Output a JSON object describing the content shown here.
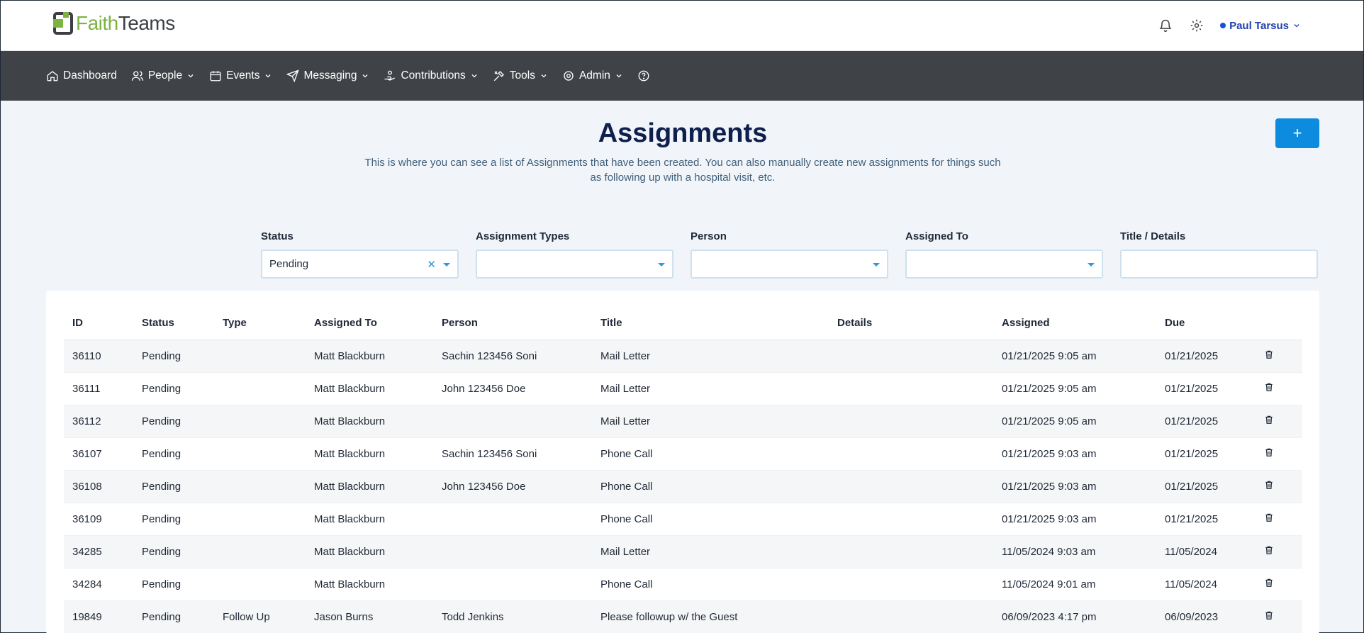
{
  "app": {
    "logo_part1": "Faith",
    "logo_part2": "Teams"
  },
  "header": {
    "user_name": "Paul Tarsus"
  },
  "nav": [
    {
      "label": "Dashboard",
      "icon": "home-icon",
      "dropdown": false
    },
    {
      "label": "People",
      "icon": "people-icon",
      "dropdown": true
    },
    {
      "label": "Events",
      "icon": "calendar-icon",
      "dropdown": true
    },
    {
      "label": "Messaging",
      "icon": "send-icon",
      "dropdown": true
    },
    {
      "label": "Contributions",
      "icon": "hand-coin-icon",
      "dropdown": true
    },
    {
      "label": "Tools",
      "icon": "tools-icon",
      "dropdown": true
    },
    {
      "label": "Admin",
      "icon": "gear-icon",
      "dropdown": true
    }
  ],
  "page": {
    "title": "Assignments",
    "description": "This is where you can see a list of Assignments that have been created. You can also manually create new assignments for things such as following up with a hospital visit, etc.",
    "add_label": "+"
  },
  "filters": {
    "status_label": "Status",
    "status_value": "Pending",
    "types_label": "Assignment Types",
    "types_value": "",
    "person_label": "Person",
    "person_value": "",
    "assigned_to_label": "Assigned To",
    "assigned_to_value": "",
    "title_label": "Title / Details",
    "title_value": ""
  },
  "table": {
    "headers": [
      "ID",
      "Status",
      "Type",
      "Assigned To",
      "Person",
      "Title",
      "Details",
      "Assigned",
      "Due",
      ""
    ],
    "rows": [
      [
        "36110",
        "Pending",
        "",
        "Matt Blackburn",
        "Sachin 123456 Soni",
        "Mail Letter",
        "",
        "01/21/2025 9:05 am",
        "01/21/2025"
      ],
      [
        "36111",
        "Pending",
        "",
        "Matt Blackburn",
        "John 123456 Doe",
        "Mail Letter",
        "",
        "01/21/2025 9:05 am",
        "01/21/2025"
      ],
      [
        "36112",
        "Pending",
        "",
        "Matt Blackburn",
        "",
        "Mail Letter",
        "",
        "01/21/2025 9:05 am",
        "01/21/2025"
      ],
      [
        "36107",
        "Pending",
        "",
        "Matt Blackburn",
        "Sachin 123456 Soni",
        "Phone Call",
        "",
        "01/21/2025 9:03 am",
        "01/21/2025"
      ],
      [
        "36108",
        "Pending",
        "",
        "Matt Blackburn",
        "John 123456 Doe",
        "Phone Call",
        "",
        "01/21/2025 9:03 am",
        "01/21/2025"
      ],
      [
        "36109",
        "Pending",
        "",
        "Matt Blackburn",
        "",
        "Phone Call",
        "",
        "01/21/2025 9:03 am",
        "01/21/2025"
      ],
      [
        "34285",
        "Pending",
        "",
        "Matt Blackburn",
        "",
        "Mail Letter",
        "",
        "11/05/2024 9:03 am",
        "11/05/2024"
      ],
      [
        "34284",
        "Pending",
        "",
        "Matt Blackburn",
        "",
        "Phone Call",
        "",
        "11/05/2024 9:01 am",
        "11/05/2024"
      ],
      [
        "19849",
        "Pending",
        "Follow Up",
        "Jason Burns",
        "Todd Jenkins",
        "Please followup w/ the Guest",
        "",
        "06/09/2023 4:17 pm",
        "06/09/2023"
      ]
    ]
  },
  "colors": {
    "accent": "#0d8bde",
    "nav_bg": "#3f4347",
    "title": "#0f1f4d",
    "logo_green": "#7cb342"
  }
}
